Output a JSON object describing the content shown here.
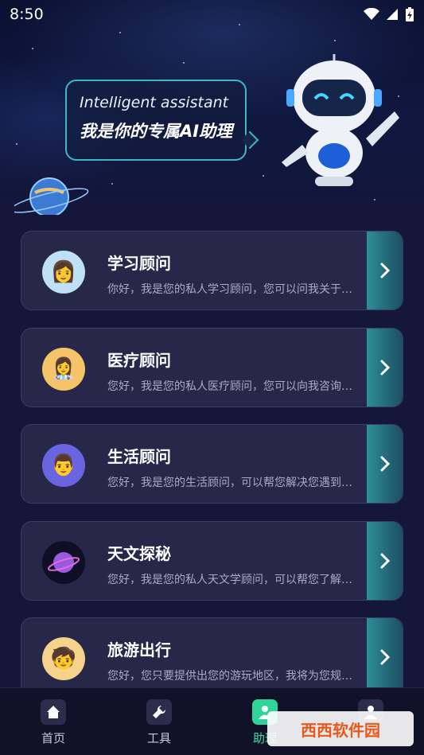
{
  "status_bar": {
    "time": "8:50"
  },
  "hero": {
    "subtitle_en": "Intelligent assistant",
    "title_cn": "我是你的专属AI助理"
  },
  "advisors": [
    {
      "title": "学习顾问",
      "desc": "你好，我是您的私人学习顾问，您可以问我关于学习的问题",
      "icon": "student-avatar"
    },
    {
      "title": "医疗顾问",
      "desc": "您好，我是您的私人医疗顾问，您可以向我咨询健康问题",
      "icon": "nurse-avatar"
    },
    {
      "title": "生活顾问",
      "desc": "您好，我是您的生活顾问，可以帮您解决您遇到的问题",
      "icon": "man-avatar"
    },
    {
      "title": "天文探秘",
      "desc": "您好，我是您的私人天文学顾问，可以帮您了解宇宙奥秘",
      "icon": "planet-avatar"
    },
    {
      "title": "旅游出行",
      "desc": "您好，您只要提供出您的游玩地区，我将为您规划行程",
      "icon": "traveler-avatar"
    }
  ],
  "nav": {
    "home": "首页",
    "tools": "工具",
    "assistant": "助理",
    "active": "assistant"
  },
  "watermark": "西西软件园",
  "colors": {
    "accent": "#2fd49b",
    "card": "#262749",
    "bubble_border": "#3fb6c7"
  }
}
